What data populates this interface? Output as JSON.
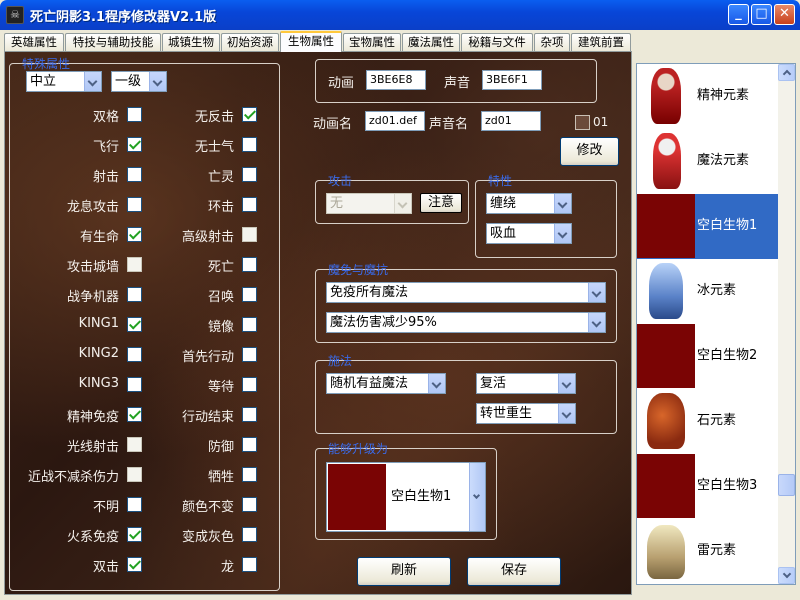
{
  "window": {
    "title": "死亡阴影3.1程序修改器V2.1版",
    "app_icon": "skull-icon"
  },
  "tabs": [
    "英雄属性",
    "特技与辅助技能",
    "城镇生物",
    "初始资源",
    "生物属性",
    "宝物属性",
    "魔法属性",
    "秘籍与文件",
    "杂项",
    "建筑前置"
  ],
  "active_tab": "生物属性",
  "left_group": {
    "legend": "特殊属性",
    "alignment": "中立",
    "level": "一级",
    "left_col": [
      {
        "label": "双格",
        "checked": false
      },
      {
        "label": "飞行",
        "checked": true
      },
      {
        "label": "射击",
        "checked": false
      },
      {
        "label": "龙息攻击",
        "checked": false
      },
      {
        "label": "有生命",
        "checked": true
      },
      {
        "label": "攻击城墙",
        "checked": false,
        "disabled": true
      },
      {
        "label": "战争机器",
        "checked": false
      },
      {
        "label": "KING1",
        "checked": true
      },
      {
        "label": "KING2",
        "checked": false
      },
      {
        "label": "KING3",
        "checked": false
      },
      {
        "label": "精神免疫",
        "checked": true
      },
      {
        "label": "光线射击",
        "checked": false,
        "disabled": true
      },
      {
        "label": "近战不减杀伤力",
        "checked": false,
        "disabled": true
      },
      {
        "label": "不明",
        "checked": false
      },
      {
        "label": "火系免疫",
        "checked": true
      },
      {
        "label": "双击",
        "checked": true
      }
    ],
    "right_col": [
      {
        "label": "无反击",
        "checked": true
      },
      {
        "label": "无士气",
        "checked": false
      },
      {
        "label": "亡灵",
        "checked": false
      },
      {
        "label": "环击",
        "checked": false
      },
      {
        "label": "高级射击",
        "checked": false,
        "disabled": true
      },
      {
        "label": "死亡",
        "checked": false
      },
      {
        "label": "召唤",
        "checked": false
      },
      {
        "label": "镜像",
        "checked": false
      },
      {
        "label": "首先行动",
        "checked": false
      },
      {
        "label": "等待",
        "checked": false
      },
      {
        "label": "行动结束",
        "checked": false
      },
      {
        "label": "防御",
        "checked": false
      },
      {
        "label": "牺牲",
        "checked": false
      },
      {
        "label": "颜色不变",
        "checked": false
      },
      {
        "label": "变成灰色",
        "checked": false
      },
      {
        "label": "龙",
        "checked": false
      }
    ]
  },
  "animation": {
    "anim_label": "动画",
    "anim_value": "3BE6E8",
    "sound_label": "声音",
    "sound_value": "3BE6F1",
    "anim_name_label": "动画名",
    "anim_name_value": "zd01.def",
    "sound_name_label": "声音名",
    "sound_name_value": "zd01",
    "checkbox_label": "01",
    "modify_button": "修改"
  },
  "attack_group": {
    "legend": "攻击",
    "select_value": "无",
    "note_button": "注意"
  },
  "trait_group": {
    "legend": "特性",
    "select1": "缠绕",
    "select2": "吸血"
  },
  "magic_resist_group": {
    "legend": "魔免与魔抗",
    "select1": "免疫所有魔法",
    "select2": "魔法伤害减少95%"
  },
  "spell_group": {
    "legend": "施法",
    "select1": "随机有益魔法",
    "select2": "复活",
    "select3": "转世重生"
  },
  "upgrade_group": {
    "legend": "能够升级为",
    "select_value": "空白生物1"
  },
  "bottom_buttons": {
    "refresh": "刷新",
    "save": "保存"
  },
  "creature_list": [
    {
      "name": "精神元素",
      "art": "psychic-elemental-icon",
      "selected": false
    },
    {
      "name": "魔法元素",
      "art": "magic-elemental-icon",
      "selected": false
    },
    {
      "name": "空白生物1",
      "art": "blank-creature-icon",
      "selected": true
    },
    {
      "name": "冰元素",
      "art": "ice-elemental-icon",
      "selected": false
    },
    {
      "name": "空白生物2",
      "art": "blank-creature-icon",
      "selected": false
    },
    {
      "name": "石元素",
      "art": "stone-elemental-icon",
      "selected": false
    },
    {
      "name": "空白生物3",
      "art": "blank-creature-icon",
      "selected": false
    },
    {
      "name": "雷元素",
      "art": "storm-elemental-icon",
      "selected": false
    }
  ],
  "colors": {
    "selection": "#316ac5",
    "blank_creature": "#7a0404",
    "legend": "#3a6ae8"
  }
}
